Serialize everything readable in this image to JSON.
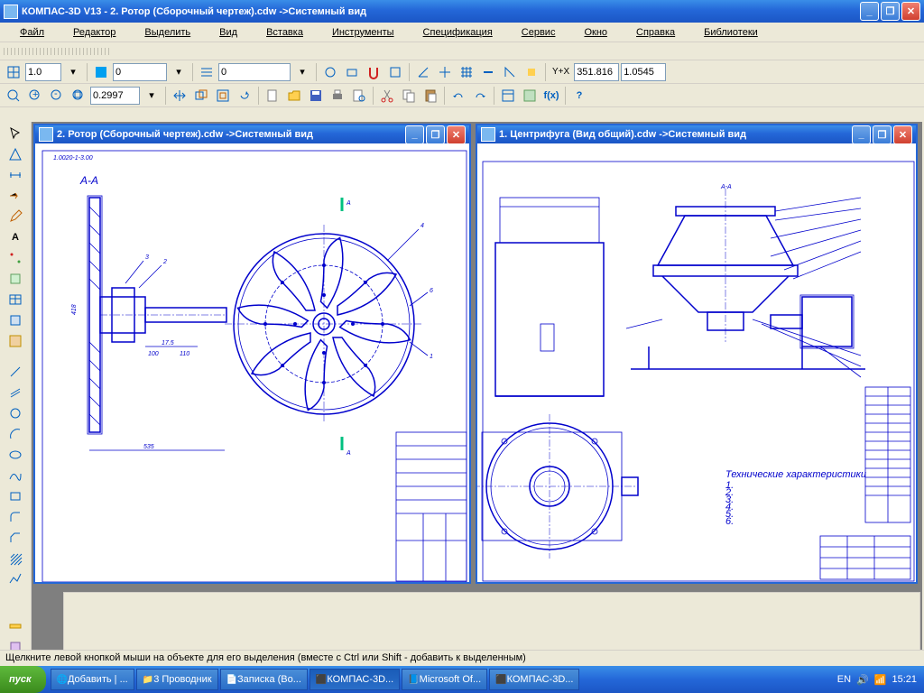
{
  "app": {
    "title": "КОМПАС-3D V13 - 2. Ротор (Сборочный чертеж).cdw ->Системный вид"
  },
  "menu": {
    "file": "Файл",
    "editor": "Редактор",
    "select": "Выделить",
    "view": "Вид",
    "insert": "Вставка",
    "tools": "Инструменты",
    "spec": "Спецификация",
    "service": "Сервис",
    "window": "Окно",
    "help": "Справка",
    "libs": "Библиотеки"
  },
  "toolbar2": {
    "lineweight": "1.0",
    "layer": "0",
    "combo3": "0"
  },
  "toolbar3": {
    "zoom": "0.2997",
    "coord_x_label": "Y+X",
    "coord_x": "351.816",
    "coord_y": "1.0545"
  },
  "doc1": {
    "title": "2. Ротор (Сборочный чертеж).cdw ->Системный вид",
    "section_label": "А-А",
    "part_code": "1.0020-1-3.00"
  },
  "doc2": {
    "title": "1. Центрифуга (Вид общий).cdw ->Системный вид"
  },
  "status": {
    "text": "Щелкните левой кнопкой мыши на объекте для его выделения (вместе с Ctrl или Shift - добавить к выделенным)"
  },
  "taskbar": {
    "start": "пуск",
    "items": [
      "Добавить | ...",
      "3 Проводник",
      "Записка (Во...",
      "КОМПАС-3D...",
      "Microsoft Of...",
      "КОМПАС-3D..."
    ],
    "lang": "EN",
    "clock": "15:21"
  }
}
